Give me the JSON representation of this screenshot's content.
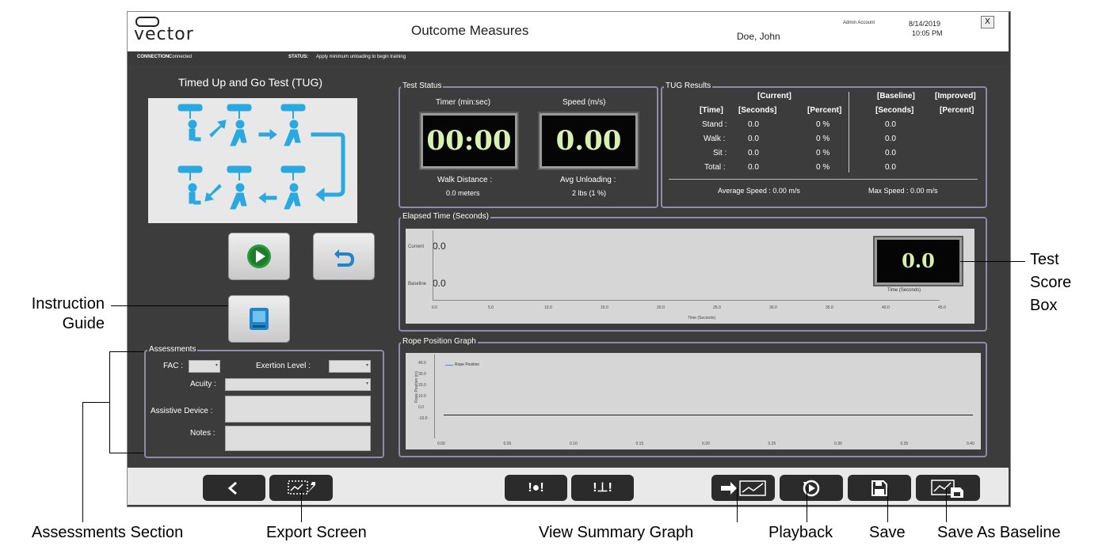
{
  "header": {
    "logo": "vector",
    "title": "Outcome Measures",
    "patient": "Doe, John",
    "account": "Admin Account",
    "date": "8/14/2019",
    "time": "10:05 PM",
    "close_label": "X"
  },
  "statusbar": {
    "connection_label": "CONNECTION:",
    "connection_value": "Connected",
    "status_label": "STATUS:",
    "status_value": "Apply minimum unloading to begin training"
  },
  "left": {
    "test_title": "Timed Up and Go Test (TUG)"
  },
  "test_status": {
    "label": "Test Status",
    "timer_label": "Timer (min:sec)",
    "timer_value": "00:00",
    "speed_label": "Speed (m/s)",
    "speed_value": "0.00",
    "walk_label": "Walk Distance :",
    "walk_value": "0.0 meters",
    "unload_label": "Avg Unloading :",
    "unload_value": "2  lbs (1 %)"
  },
  "tug": {
    "label": "TUG Results",
    "current": "[Current]",
    "baseline": "[Baseline]",
    "improved": "[Improved]",
    "col_time": "[Time]",
    "col_seconds": "[Seconds]",
    "col_percent": "[Percent]",
    "col_bseconds": "[Seconds]",
    "col_ipercent": "[Percent]",
    "rows": [
      {
        "name": "Stand :",
        "sec": "0.0",
        "pct": "0 %",
        "base": "0.0"
      },
      {
        "name": "Walk :",
        "sec": "0.0",
        "pct": "0 %",
        "base": "0.0"
      },
      {
        "name": "Sit :",
        "sec": "0.0",
        "pct": "0 %",
        "base": "0.0"
      },
      {
        "name": "Total :",
        "sec": "0.0",
        "pct": "0 %",
        "base": "0.0"
      }
    ],
    "avg_speed": "Average Speed :  0.00 m/s",
    "max_speed": "Max Speed :  0.00 m/s"
  },
  "elapsed": {
    "label": "Elapsed Time (Seconds)",
    "current_label": "Current",
    "current_value": "0.0",
    "baseline_label": "Baseline",
    "baseline_value": "0.0",
    "score_value": "0.0",
    "score_caption": "Time (Seconds)",
    "xlabel": "Time (Seconds)",
    "ticks": [
      "0.0",
      "5.0",
      "10.0",
      "15.0",
      "20.0",
      "25.0",
      "30.0",
      "35.0",
      "40.0",
      "45.0"
    ]
  },
  "rope": {
    "label": "Rope Position Graph",
    "legend": "Rope Position",
    "ylabel": "Rope Position (in)",
    "yticks": [
      "40.0",
      "30.0",
      "20.0",
      "10.0",
      "0.0",
      "-10.0"
    ],
    "xticks": [
      "0.00",
      "0.05",
      "0.10",
      "0.15",
      "0.20",
      "0.25",
      "0.30",
      "0.35",
      "0.40"
    ]
  },
  "assessments": {
    "label": "Assessments",
    "fac": "FAC :",
    "exertion": "Exertion Level :",
    "acuity": "Acuity :",
    "device": "Assistive Device :",
    "notes": "Notes :"
  },
  "callouts": {
    "instruction_line1": "Instruction",
    "instruction_line2": "Guide",
    "score_line1": "Test",
    "score_line2": "Score",
    "score_line3": "Box",
    "assessments": "Assessments Section",
    "export": "Export Screen",
    "summary": "View Summary Graph",
    "playback": "Playback",
    "save": "Save",
    "save_baseline": "Save As Baseline"
  },
  "footer": {
    "warn1": "!●!",
    "warn2": "!⊥!"
  }
}
